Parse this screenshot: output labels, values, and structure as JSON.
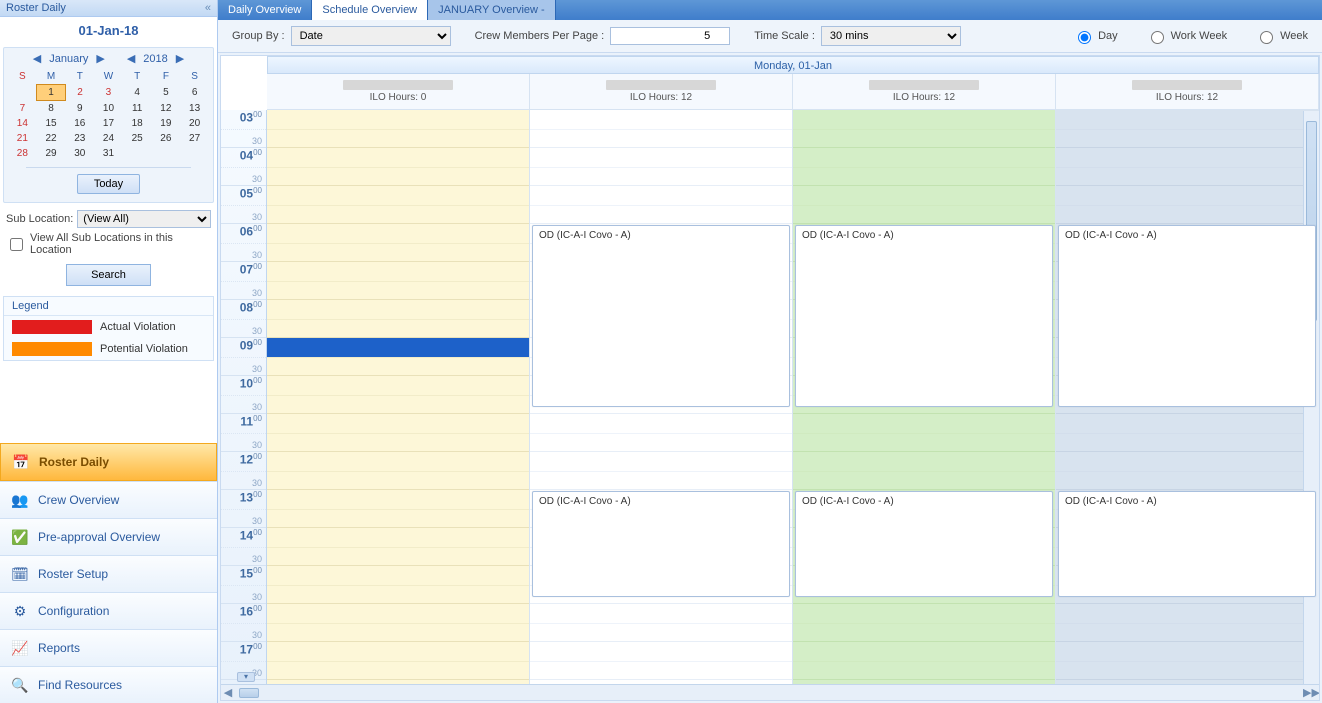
{
  "sidebar": {
    "title": "Roster Daily",
    "date": "01-Jan-18",
    "month": "January",
    "year": "2018",
    "dows": [
      "S",
      "M",
      "T",
      "W",
      "T",
      "F",
      "S"
    ],
    "weeks": [
      [
        "",
        "1",
        "2",
        "3",
        "4",
        "5",
        "6"
      ],
      [
        "7",
        "8",
        "9",
        "10",
        "11",
        "12",
        "13"
      ],
      [
        "14",
        "15",
        "16",
        "17",
        "18",
        "19",
        "20"
      ],
      [
        "21",
        "22",
        "23",
        "24",
        "25",
        "26",
        "27"
      ],
      [
        "28",
        "29",
        "30",
        "31",
        "",
        "",
        ""
      ]
    ],
    "today_btn": "Today",
    "subloc_label": "Sub Location:",
    "subloc_value": "(View All)",
    "viewall_label": "View All Sub Locations in this Location",
    "search": "Search",
    "legend_title": "Legend",
    "legend": [
      {
        "color": "#e21d1d",
        "label": "Actual Violation"
      },
      {
        "color": "#ff8a00",
        "label": "Potential Violation"
      }
    ],
    "modules": [
      {
        "label": "Roster Daily",
        "active": true,
        "icon": "📅"
      },
      {
        "label": "Crew Overview",
        "active": false,
        "icon": "👥"
      },
      {
        "label": "Pre-approval Overview",
        "active": false,
        "icon": "✅"
      },
      {
        "label": "Roster Setup",
        "active": false,
        "icon": "🗓"
      },
      {
        "label": "Configuration",
        "active": false,
        "icon": "⚙"
      },
      {
        "label": "Reports",
        "active": false,
        "icon": "📈"
      },
      {
        "label": "Find Resources",
        "active": false,
        "icon": "🔍"
      }
    ]
  },
  "tabs": [
    {
      "label": "Daily Overview",
      "state": "norm"
    },
    {
      "label": "Schedule Overview",
      "state": "act"
    },
    {
      "label": "JANUARY Overview -",
      "state": "sec"
    }
  ],
  "toolbar": {
    "groupby_label": "Group By :",
    "groupby_value": "Date",
    "crewpp_label": "Crew Members Per Page :",
    "crewpp_value": "5",
    "timescale_label": "Time Scale :",
    "timescale_value": "30 mins",
    "views": [
      "Day",
      "Work Week",
      "Week"
    ],
    "view_selected": "Day"
  },
  "schedule": {
    "day_label": "Monday, 01-Jan",
    "columns": [
      {
        "ilo": "ILO Hours: 0"
      },
      {
        "ilo": "ILO Hours: 12"
      },
      {
        "ilo": "ILO Hours: 12"
      },
      {
        "ilo": "ILO Hours: 12"
      }
    ],
    "hours": [
      "03",
      "04",
      "05",
      "06",
      "07",
      "08",
      "09",
      "10",
      "11",
      "12",
      "13",
      "14",
      "15",
      "16",
      "17"
    ],
    "now_hour_index": 6,
    "events": [
      {
        "lane": 1,
        "start": 3,
        "span": 5,
        "label": "OD (IC-A-I Covo - A)"
      },
      {
        "lane": 2,
        "start": 3,
        "span": 5,
        "label": "OD (IC-A-I Covo - A)"
      },
      {
        "lane": 3,
        "start": 3,
        "span": 5,
        "label": "OD (IC-A-I Covo - A)"
      },
      {
        "lane": 1,
        "start": 10,
        "span": 3,
        "label": "OD (IC-A-I Covo - A)"
      },
      {
        "lane": 2,
        "start": 10,
        "span": 3,
        "label": "OD (IC-A-I Covo - A)"
      },
      {
        "lane": 3,
        "start": 10,
        "span": 3,
        "label": "OD (IC-A-I Covo - A)"
      }
    ]
  }
}
